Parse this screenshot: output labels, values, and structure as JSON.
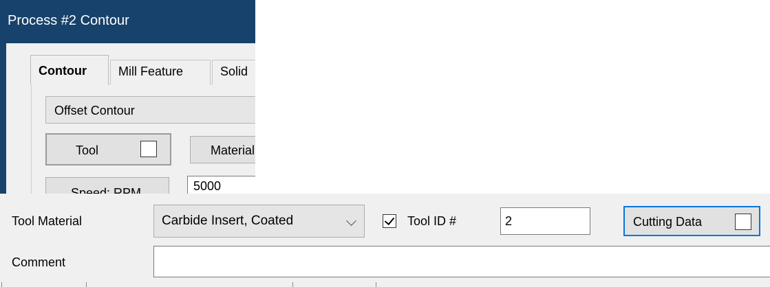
{
  "dialog": {
    "title": "Process #2 Contour",
    "tabs": [
      "Contour",
      "Mill Feature",
      "Solid"
    ],
    "active_tab": "Contour",
    "mode": "Offset Contour",
    "tool_button_label": "Tool",
    "material_button_label": "Material",
    "speed_button_label": "Speed: RPM",
    "speed_value": "5000"
  },
  "tool_panel": {
    "tool_material_label": "Tool Material",
    "tool_material_value": "Carbide Insert, Coated",
    "tool_id_label": "Tool ID #",
    "tool_id_checked": true,
    "tool_id_value": "2",
    "cutting_data_label": "Cutting Data",
    "comment_label": "Comment",
    "comment_value": ""
  },
  "colors": {
    "title_bar": "#16426b",
    "focus_border": "#0a74da",
    "panel_background": "#f0f0f0"
  }
}
